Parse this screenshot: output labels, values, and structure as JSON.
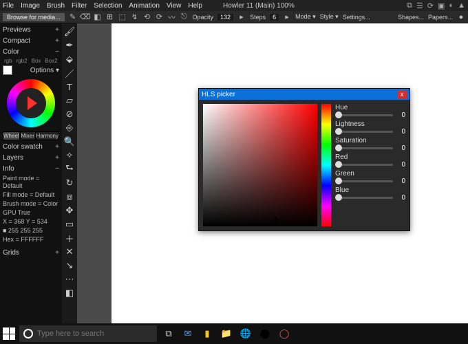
{
  "menu": {
    "items": [
      "File",
      "Image",
      "Brush",
      "Filter",
      "Selection",
      "Animation",
      "View",
      "Help"
    ],
    "title": "Howler 11 (Main)   100%"
  },
  "toolbar": {
    "browse": "Browse for media...",
    "opacity_lbl": "Opacity",
    "opacity_val": "132",
    "steps_lbl": "Steps",
    "steps_val": "6",
    "mode": "Mode",
    "style": "Style",
    "settings": "Settings...",
    "shapes": "Shapes...",
    "papers": "Papers..."
  },
  "left": {
    "previews": "Previews",
    "compact": "Compact",
    "color": "Color",
    "t1": "rgb",
    "t2": "rgb2",
    "t3": "Box",
    "t4": "Box2",
    "options": "Options",
    "wheel": "Wheel",
    "mixer": "Mixer",
    "harmony": "Harmony",
    "swatch": "Color swatch",
    "layers": "Layers",
    "info": "Info",
    "info1": "Paint mode = Default",
    "info2": "Fill mode = Default",
    "info3": "Brush mode = Color",
    "info4": "GPU  True",
    "info5": "X =  368  Y =  534",
    "info6": "■  255  255  255",
    "info7": "Hex = FFFFFF",
    "grids": "Grids"
  },
  "picker": {
    "title": "HLS picker",
    "hue": "Hue",
    "lightness": "Lightness",
    "saturation": "Saturation",
    "red": "Red",
    "green": "Green",
    "blue": "Blue",
    "v_hue": "0",
    "v_light": "0",
    "v_sat": "0",
    "v_red": "0",
    "v_green": "0",
    "v_blue": "0"
  },
  "taskbar": {
    "search_placeholder": "Type here to search"
  }
}
